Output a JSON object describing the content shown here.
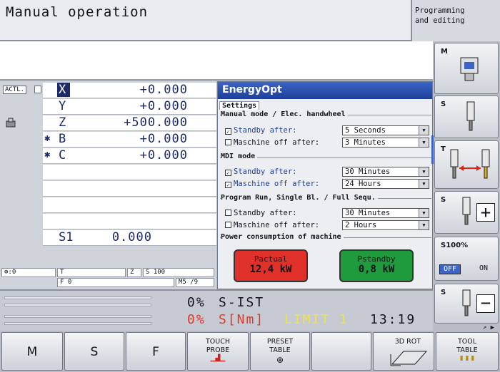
{
  "header": {
    "mode_title": "Manual operation",
    "second_mode_line1": "Programming",
    "second_mode_line2": "and editing"
  },
  "position": {
    "actl_label": "ACTL.",
    "rows": [
      {
        "axis": "X",
        "value": "+0.000",
        "mark": ""
      },
      {
        "axis": "Y",
        "value": "+0.000",
        "mark": ""
      },
      {
        "axis": "Z",
        "value": "+500.000",
        "mark": ""
      },
      {
        "axis": "B",
        "value": "+0.000",
        "mark": "✱"
      },
      {
        "axis": "C",
        "value": "+0.000",
        "mark": "✱"
      }
    ],
    "spindle_label": "S1",
    "spindle_value": "0.000"
  },
  "status_lines": {
    "tool_symbol": "⊕:0",
    "t_label": "T",
    "f_label": "F 0",
    "z_label": "Z",
    "s_label": "S 100",
    "m_label": "M5 /9"
  },
  "energyopt": {
    "title": "EnergyOpt",
    "tab": "Settings",
    "groups": [
      {
        "label": "Manual mode / Elec. handwheel",
        "options": [
          {
            "label": "Standby after:",
            "checked": true,
            "value": "5  Seconds"
          },
          {
            "label": "Maschine off after:",
            "checked": false,
            "value": "3  Minutes"
          }
        ]
      },
      {
        "label": "MDI mode",
        "options": [
          {
            "label": "Standby after:",
            "checked": true,
            "value": "30 Minutes"
          },
          {
            "label": "Maschine off after:",
            "checked": true,
            "value": "24 Hours"
          }
        ]
      },
      {
        "label": "Program Run, Single Bl. / Full Sequ.",
        "options": [
          {
            "label": "Standby after:",
            "checked": false,
            "value": "30 Minutes"
          },
          {
            "label": "Maschine off after:",
            "checked": false,
            "value": "2  Hours"
          }
        ]
      }
    ],
    "power": {
      "label": "Power consumption of machine",
      "actual_label": "Pactual",
      "actual_value": "12,4 kW",
      "standby_label": "Pstandby",
      "standby_value": "0,8 kW",
      "actual_color": "#e0302a",
      "standby_color": "#1f9a3c"
    }
  },
  "status_bar": {
    "line1_pct": "0%",
    "line1_text": "S-IST",
    "line2_pct": "0%",
    "line2_text": "S[Nm]",
    "limit_text": "LIMIT 1",
    "time": "13:19"
  },
  "right_softkeys": {
    "m": "M",
    "s": "S",
    "t": "T",
    "s_plus": "S",
    "s100": "S100%",
    "off": "OFF",
    "on": "ON",
    "s_minus": "S"
  },
  "bottom_softkeys": [
    {
      "label": "M"
    },
    {
      "label": "S"
    },
    {
      "label": "F"
    },
    {
      "label1": "TOUCH",
      "label2": "PROBE"
    },
    {
      "label1": "PRESET",
      "label2": "TABLE"
    },
    {
      "label1": ""
    },
    {
      "label1": "3D ROT"
    },
    {
      "label1": "TOOL",
      "label2": "TABLE"
    }
  ]
}
